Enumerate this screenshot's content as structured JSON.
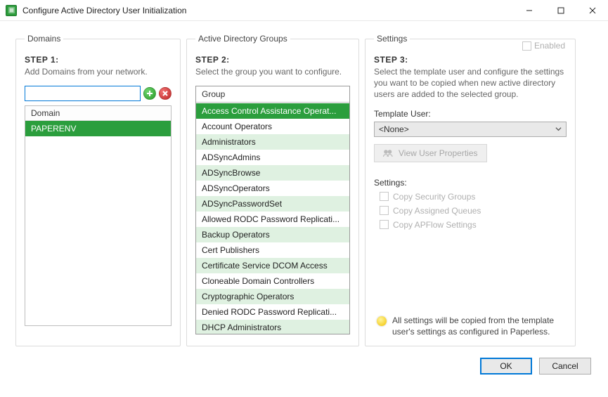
{
  "window": {
    "title": "Configure Active Directory User Initialization"
  },
  "domains": {
    "legend": "Domains",
    "step": "STEP 1:",
    "desc": "Add Domains from your network.",
    "input_value": "",
    "list_header": "Domain",
    "items": [
      "PAPERENV"
    ]
  },
  "groups": {
    "legend": "Active Directory Groups",
    "step": "STEP 2:",
    "desc": "Select the group you want to configure.",
    "list_header": "Group",
    "selected_index": 0,
    "items": [
      "Access Control Assistance Operat...",
      "Account Operators",
      "Administrators",
      "ADSyncAdmins",
      "ADSyncBrowse",
      "ADSyncOperators",
      "ADSyncPasswordSet",
      "Allowed RODC Password Replicati...",
      "Backup Operators",
      "Cert Publishers",
      "Certificate Service DCOM Access",
      "Cloneable Domain Controllers",
      "Cryptographic Operators",
      "Denied RODC Password Replicati...",
      "DHCP Administrators"
    ]
  },
  "settings": {
    "legend": "Settings",
    "enabled_label": "Enabled",
    "step": "STEP 3:",
    "desc": "Select the template user and configure the settings you want to be copied when new active directory users are added to the selected group.",
    "template_label": "Template User:",
    "template_value": "<None>",
    "view_props_btn": "View User Properties",
    "sub_label": "Settings:",
    "checks": [
      "Copy Security Groups",
      "Copy Assigned Queues",
      "Copy APFlow Settings"
    ],
    "tip": "All settings will be copied from the template user's settings as configured in Paperless."
  },
  "footer": {
    "ok": "OK",
    "cancel": "Cancel"
  }
}
